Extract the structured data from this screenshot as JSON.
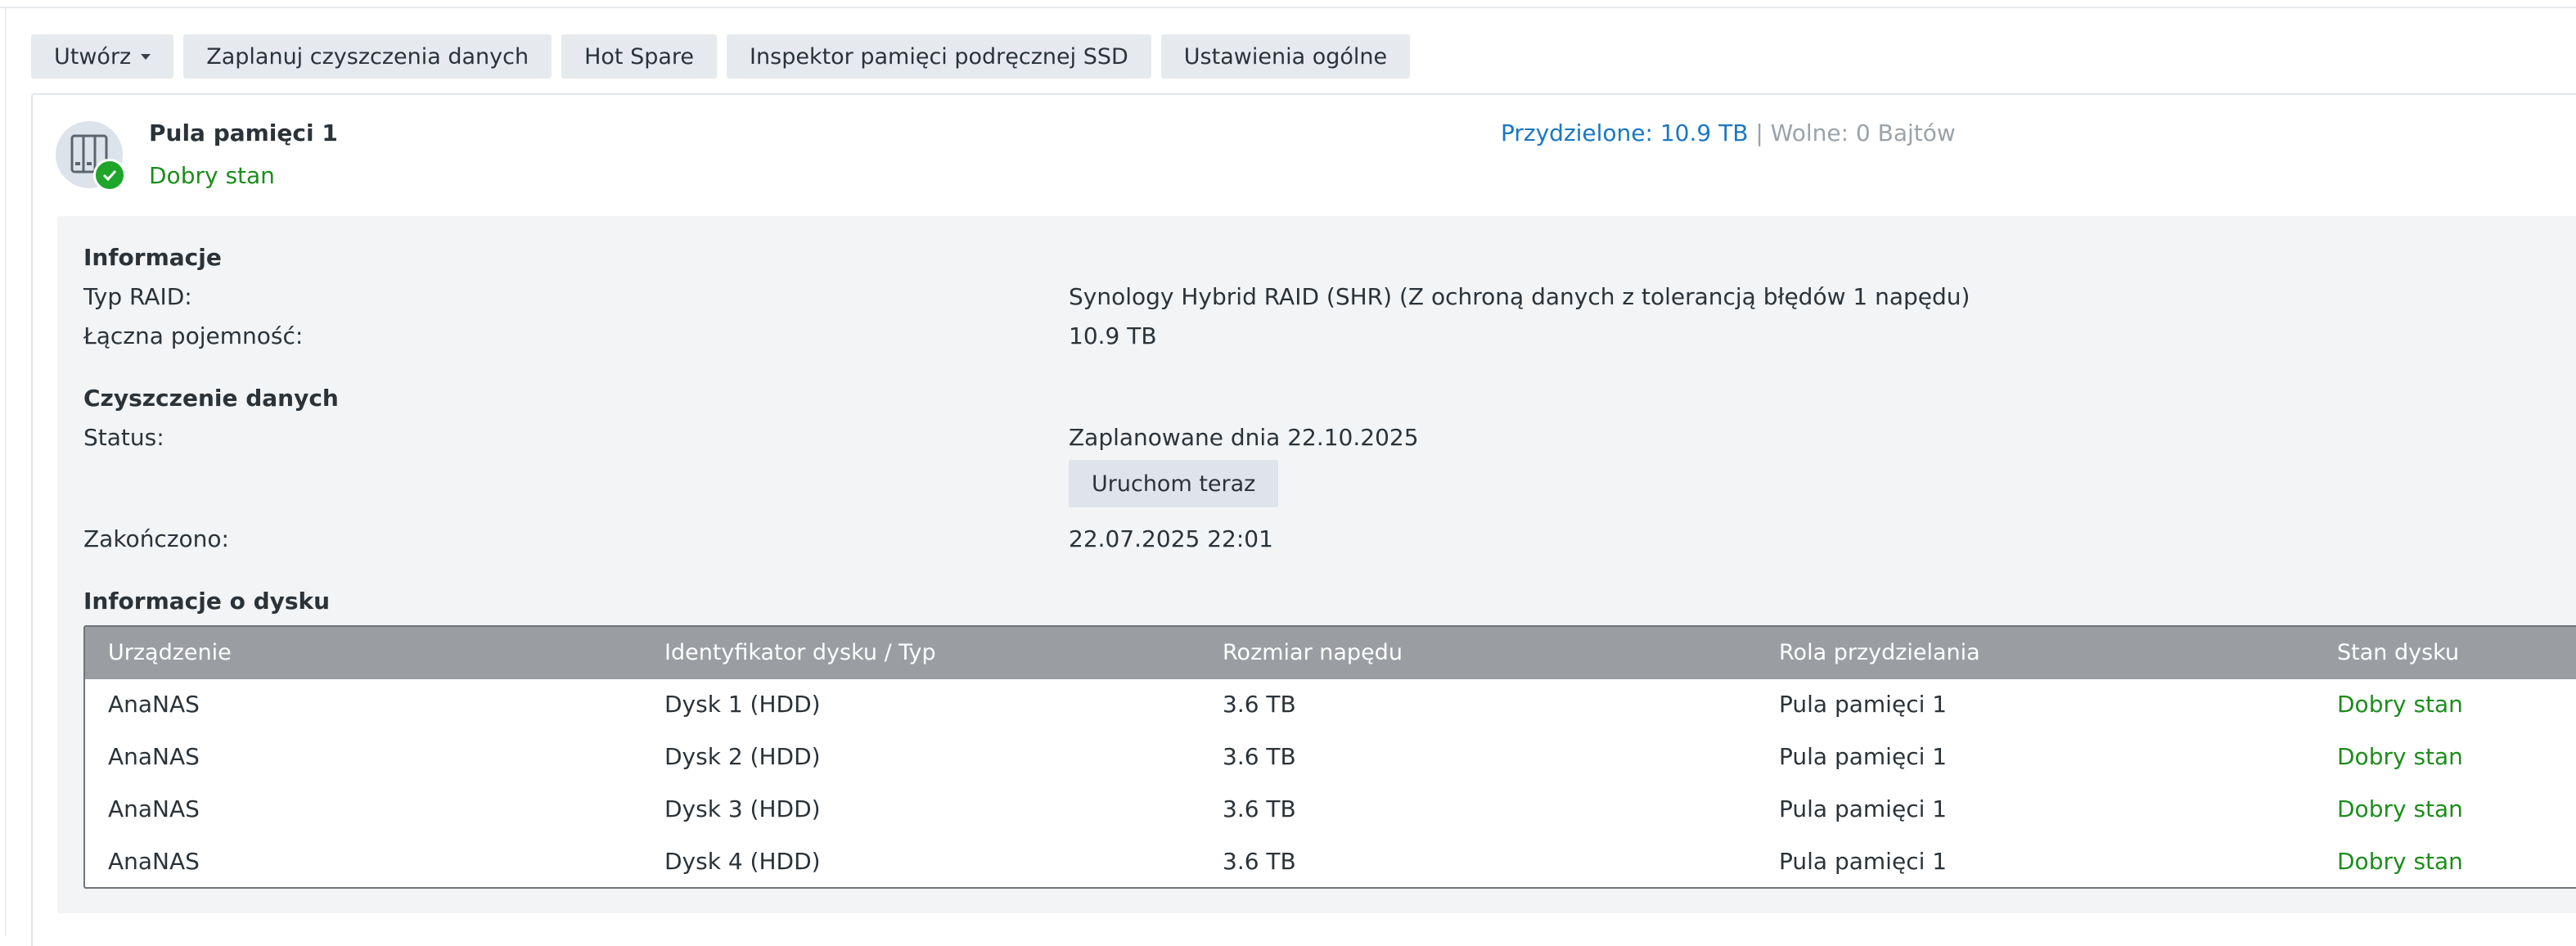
{
  "toolbar": {
    "create_label": "Utwórz",
    "schedule_label": "Zaplanuj czyszczenia danych",
    "hotspare_label": "Hot Spare",
    "ssd_label": "Inspektor pamięci podręcznej SSD",
    "settings_label": "Ustawienia ogólne"
  },
  "pool": {
    "title": "Pula pamięci 1",
    "status": "Dobry stan",
    "allocated": "Przydzielone: 10.9 TB",
    "separator": "|",
    "free": "Wolne: 0 Bajtów"
  },
  "info": {
    "section_title": "Informacje",
    "raid_label": "Typ RAID:",
    "raid_value": "Synology Hybrid RAID (SHR) (Z ochroną danych z tolerancją błędów 1 napędu)",
    "capacity_label": "Łączna pojemność:",
    "capacity_value": "10.9 TB"
  },
  "scrub": {
    "section_title": "Czyszczenie danych",
    "status_label": "Status:",
    "status_value": "Zaplanowane dnia 22.10.2025",
    "run_now_label": "Uruchom teraz",
    "finished_label": "Zakończono:",
    "finished_value": "22.07.2025 22:01"
  },
  "disks": {
    "section_title": "Informacje o dysku",
    "columns": [
      "Urządzenie",
      "Identyfikator dysku / Typ",
      "Rozmiar napędu",
      "Rola przydzielania",
      "Stan dysku"
    ],
    "rows": [
      [
        "AnaNAS",
        "Dysk 1 (HDD)",
        "3.6 TB",
        "Pula pamięci 1",
        "Dobry stan"
      ],
      [
        "AnaNAS",
        "Dysk 2 (HDD)",
        "3.6 TB",
        "Pula pamięci 1",
        "Dobry stan"
      ],
      [
        "AnaNAS",
        "Dysk 3 (HDD)",
        "3.6 TB",
        "Pula pamięci 1",
        "Dobry stan"
      ],
      [
        "AnaNAS",
        "Dysk 4 (HDD)",
        "3.6 TB",
        "Pula pamięci 1",
        "Dobry stan"
      ]
    ]
  },
  "icons": {
    "pool": "storage-pool-icon",
    "status_ok": "checkmark-icon",
    "dropdown": "caret-down-icon"
  },
  "colors": {
    "ok_green": "#1d8d1d",
    "accent_blue": "#1a78c2",
    "header_grey": "#9a9ea3"
  }
}
